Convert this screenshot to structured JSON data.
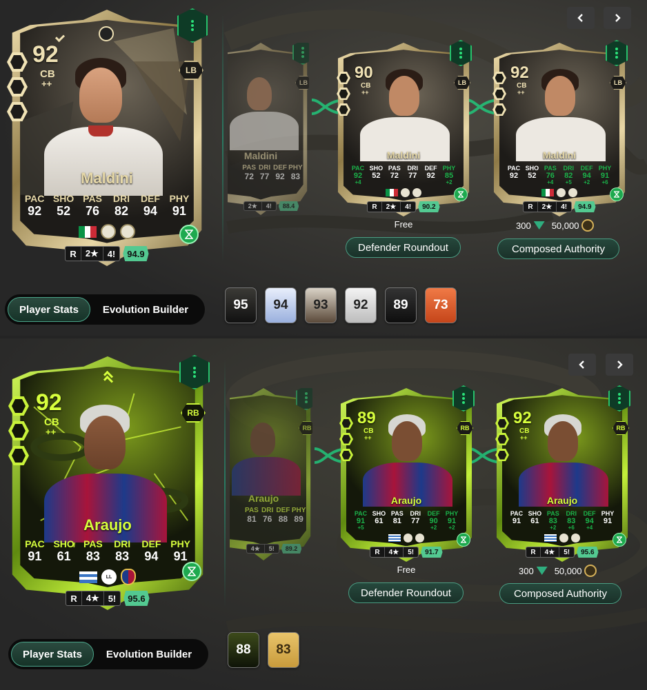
{
  "sections": [
    {
      "main_card": {
        "rating": "92",
        "position": "CB",
        "position_plus": "++",
        "alt_position": "LB",
        "name": "Maldini",
        "stats": [
          {
            "label": "PAC",
            "value": "92"
          },
          {
            "label": "SHO",
            "value": "52"
          },
          {
            "label": "PAS",
            "value": "76"
          },
          {
            "label": "DRI",
            "value": "82"
          },
          {
            "label": "DEF",
            "value": "94"
          },
          {
            "label": "PHY",
            "value": "91"
          }
        ],
        "foot": "R",
        "skill": "2★",
        "weak": "4!",
        "score": "94.9"
      },
      "partial_card": {
        "name": "Maldini",
        "stats": [
          {
            "label": "PAS",
            "value": "72"
          },
          {
            "label": "DRI",
            "value": "77"
          },
          {
            "label": "DEF",
            "value": "92"
          },
          {
            "label": "PHY",
            "value": "83"
          }
        ],
        "skill": "2★",
        "weak": "4!",
        "score": "88.4"
      },
      "evo_cards": [
        {
          "rating": "90",
          "position": "CB",
          "position_plus": "++",
          "alt_position": "LB",
          "name": "Maldini",
          "stats": [
            {
              "label": "PAC",
              "value": "92",
              "boost": "+4"
            },
            {
              "label": "SHO",
              "value": "52",
              "boost": ""
            },
            {
              "label": "PAS",
              "value": "72",
              "boost": ""
            },
            {
              "label": "DRI",
              "value": "77",
              "boost": ""
            },
            {
              "label": "DEF",
              "value": "92",
              "boost": ""
            },
            {
              "label": "PHY",
              "value": "85",
              "boost": "+2"
            }
          ],
          "foot": "R",
          "skill": "2★",
          "weak": "4!",
          "score": "90.2"
        },
        {
          "rating": "92",
          "position": "CB",
          "position_plus": "++",
          "alt_position": "LB",
          "name": "Maldini",
          "stats": [
            {
              "label": "PAC",
              "value": "92",
              "boost": ""
            },
            {
              "label": "SHO",
              "value": "52",
              "boost": ""
            },
            {
              "label": "PAS",
              "value": "76",
              "boost": "+4"
            },
            {
              "label": "DRI",
              "value": "82",
              "boost": "+5"
            },
            {
              "label": "DEF",
              "value": "94",
              "boost": "+2"
            },
            {
              "label": "PHY",
              "value": "91",
              "boost": "+6"
            }
          ],
          "foot": "R",
          "skill": "2★",
          "weak": "4!",
          "score": "94.9"
        }
      ],
      "evo1": {
        "price": "Free",
        "button": "Defender Roundout"
      },
      "evo2": {
        "cost_points": "300",
        "cost_coins": "50,000",
        "button": "Composed Authority"
      },
      "toggle": {
        "stats": "Player Stats",
        "builder": "Evolution Builder"
      },
      "mini_cards": [
        "95",
        "94",
        "93",
        "92",
        "89",
        "73"
      ]
    },
    {
      "main_card": {
        "rating": "92",
        "position": "CB",
        "position_plus": "++",
        "alt_position": "RB",
        "name": "Araujo",
        "stats": [
          {
            "label": "PAC",
            "value": "91"
          },
          {
            "label": "SHO",
            "value": "61"
          },
          {
            "label": "PAS",
            "value": "83"
          },
          {
            "label": "DRI",
            "value": "83"
          },
          {
            "label": "DEF",
            "value": "94"
          },
          {
            "label": "PHY",
            "value": "91"
          }
        ],
        "foot": "R",
        "skill": "4★",
        "weak": "5!",
        "score": "95.6"
      },
      "partial_card": {
        "name": "Araujo",
        "stats": [
          {
            "label": "PAS",
            "value": "81"
          },
          {
            "label": "DRI",
            "value": "76"
          },
          {
            "label": "DEF",
            "value": "88"
          },
          {
            "label": "PHY",
            "value": "89"
          }
        ],
        "skill": "4★",
        "weak": "5!",
        "score": "89.2"
      },
      "evo_cards": [
        {
          "rating": "89",
          "position": "CB",
          "position_plus": "++",
          "alt_position": "RB",
          "name": "Araujo",
          "stats": [
            {
              "label": "PAC",
              "value": "91",
              "boost": "+5"
            },
            {
              "label": "SHO",
              "value": "61",
              "boost": ""
            },
            {
              "label": "PAS",
              "value": "81",
              "boost": ""
            },
            {
              "label": "DRI",
              "value": "77",
              "boost": ""
            },
            {
              "label": "DEF",
              "value": "90",
              "boost": "+2"
            },
            {
              "label": "PHY",
              "value": "91",
              "boost": "+2"
            }
          ],
          "foot": "R",
          "skill": "4★",
          "weak": "5!",
          "score": "91.7"
        },
        {
          "rating": "92",
          "position": "CB",
          "position_plus": "++",
          "alt_position": "RB",
          "name": "Araujo",
          "stats": [
            {
              "label": "PAC",
              "value": "91",
              "boost": ""
            },
            {
              "label": "SHO",
              "value": "61",
              "boost": ""
            },
            {
              "label": "PAS",
              "value": "83",
              "boost": "+2"
            },
            {
              "label": "DRI",
              "value": "83",
              "boost": "+6"
            },
            {
              "label": "DEF",
              "value": "94",
              "boost": "+4"
            },
            {
              "label": "PHY",
              "value": "91",
              "boost": ""
            }
          ],
          "foot": "R",
          "skill": "4★",
          "weak": "5!",
          "score": "95.6"
        }
      ],
      "evo1": {
        "price": "Free",
        "button": "Defender Roundout"
      },
      "evo2": {
        "cost_points": "300",
        "cost_coins": "50,000",
        "button": "Composed Authority"
      },
      "toggle": {
        "stats": "Player Stats",
        "builder": "Evolution Builder"
      },
      "mini_cards": [
        "88",
        "83"
      ]
    }
  ],
  "colors": {
    "icon_gold": "#d8c58a",
    "icon_green": "#c5f03a",
    "accent_green": "#2be37a",
    "score_green": "#53c991",
    "boost_green": "#1bb24a"
  }
}
